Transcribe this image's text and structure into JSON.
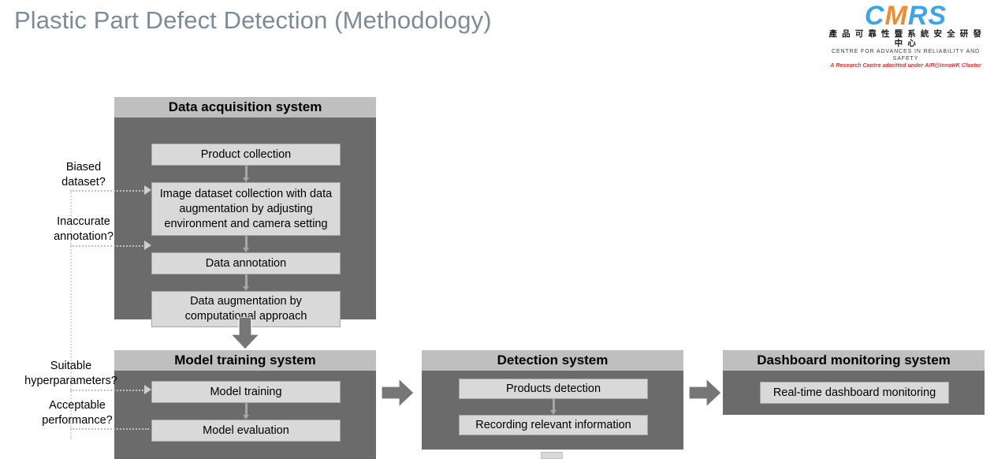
{
  "slide": {
    "title": "Plastic Part Defect Detection (Methodology)",
    "title_color": "#7c8b99",
    "background": "#ffffff"
  },
  "logo": {
    "mark": "CMRS",
    "chinese": "產 品 可 靠 性 暨 系 統 安 全 研 發 中 心",
    "english": "CENTRE FOR ADVANCES IN RELIABILITY AND SAFETY",
    "subtitle": "A Research Centre admitted under AIR@InnoHK Cluster",
    "colors": {
      "mark_blue": "#3aa6e8",
      "mark_orange": "#f08a2a",
      "subtitle_red": "#e2322a"
    }
  },
  "theme": {
    "panel_header_bg": "#bfbfbf",
    "panel_body_bg": "#6b6b6b",
    "process_box_bg": "#d9d9d9",
    "arrow_gray": "#6f6f6f",
    "thin_arrow_gray": "#a6a6a6",
    "dotted_gray": "#cfcfcf"
  },
  "panels": [
    {
      "id": "data-acquisition-system",
      "title": "Data acquisition system",
      "steps": [
        {
          "id": "product-collection",
          "label": "Product collection"
        },
        {
          "id": "image-dataset-collection",
          "label": "Image dataset collection with data augmentation by adjusting environment and camera setting"
        },
        {
          "id": "data-annotation",
          "label": "Data annotation"
        },
        {
          "id": "data-augmentation-computational",
          "label": "Data  augmentation by computational approach"
        }
      ]
    },
    {
      "id": "model-training-system",
      "title": "Model training system",
      "steps": [
        {
          "id": "model-training",
          "label": "Model training"
        },
        {
          "id": "model-evaluation",
          "label": "Model evaluation"
        }
      ]
    },
    {
      "id": "detection-system",
      "title": "Detection system",
      "steps": [
        {
          "id": "products-detection",
          "label": "Products detection"
        },
        {
          "id": "recording-relevant-information",
          "label": "Recording relevant information"
        }
      ]
    },
    {
      "id": "dashboard-monitoring-system",
      "title": "Dashboard monitoring system",
      "steps": [
        {
          "id": "real-time-dashboard-monitoring",
          "label": "Real-time dashboard monitoring"
        }
      ]
    }
  ],
  "feedback_labels": [
    {
      "id": "biased-dataset",
      "text": "Biased\ndataset?"
    },
    {
      "id": "inaccurate-annotation",
      "text": "Inaccurate\nannotation?"
    },
    {
      "id": "suitable-hyperparameters",
      "text": "Suitable\nhyperparameters?"
    },
    {
      "id": "acceptable-performance",
      "text": "Acceptable\nperformance?"
    }
  ]
}
